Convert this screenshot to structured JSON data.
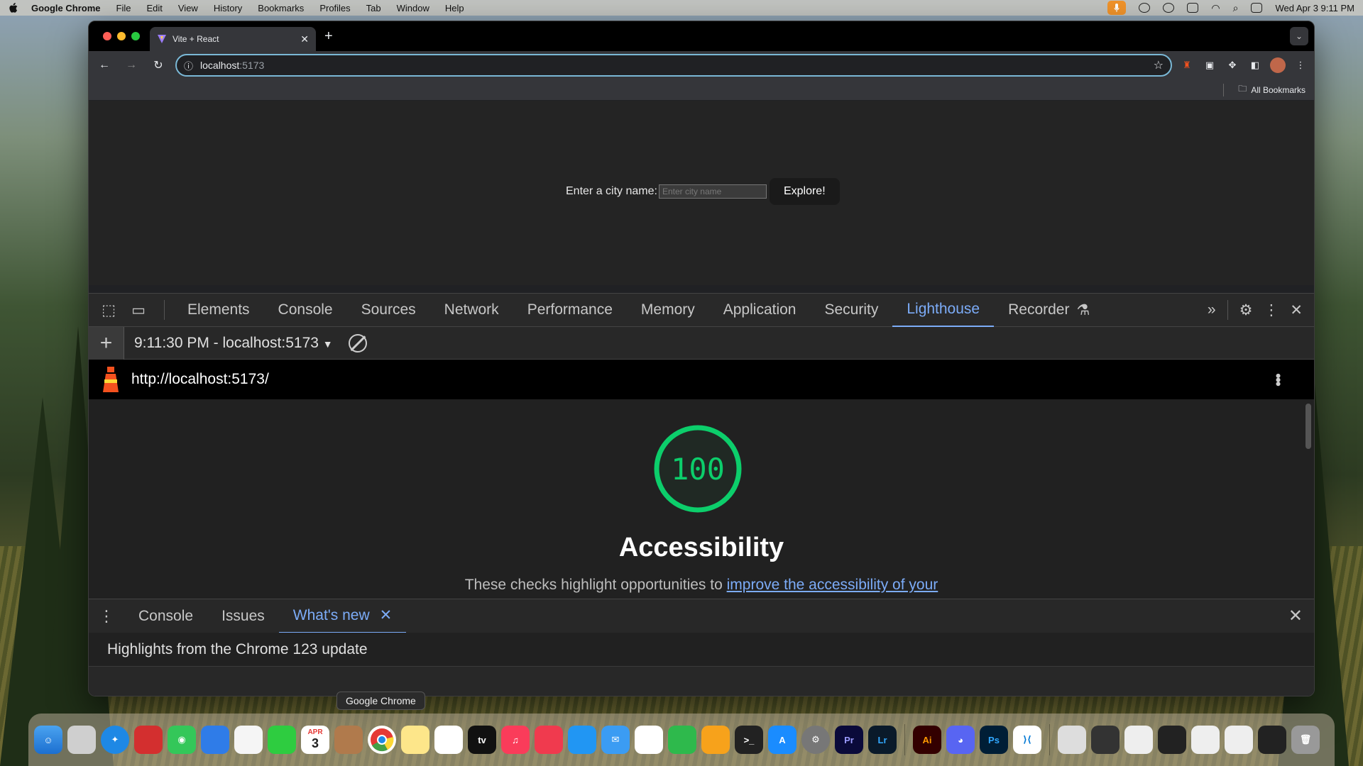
{
  "menubar": {
    "app_name": "Google Chrome",
    "items": [
      "File",
      "Edit",
      "View",
      "History",
      "Bookmarks",
      "Profiles",
      "Tab",
      "Window",
      "Help"
    ],
    "clock": "Wed Apr 3  9:11 PM"
  },
  "browser": {
    "tab_title": "Vite + React",
    "url_host": "localhost",
    "url_port": ":5173",
    "bookmarks_label": "All Bookmarks"
  },
  "page": {
    "city_label": "Enter a city name:",
    "city_placeholder": "Enter city name",
    "explore_label": "Explore!"
  },
  "devtools": {
    "tabs": [
      "Elements",
      "Console",
      "Sources",
      "Network",
      "Performance",
      "Memory",
      "Application",
      "Security",
      "Lighthouse",
      "Recorder"
    ],
    "active_tab": "Lighthouse",
    "report_selector": "9:11:30 PM - localhost:5173",
    "report_url": "http://localhost:5173/",
    "score": "100",
    "score_fraction": 1.0,
    "category": "Accessibility",
    "desc_prefix": "These checks highlight opportunities to ",
    "desc_link": "improve the accessibility of your"
  },
  "drawer": {
    "tabs": [
      "Console",
      "Issues",
      "What's new"
    ],
    "active_tab": "What's new",
    "headline": "Highlights from the Chrome 123 update"
  },
  "dock": {
    "tooltip": "Google Chrome",
    "calendar_month": "APR",
    "calendar_day": "3",
    "apps": [
      "Pr",
      "Lr",
      "Ai",
      "Ps"
    ]
  },
  "colors": {
    "score_green": "#0cce6b",
    "accent_blue": "#7cacf8"
  }
}
